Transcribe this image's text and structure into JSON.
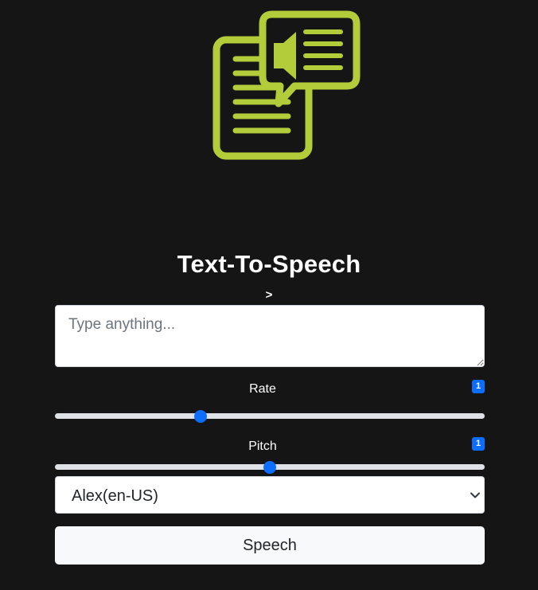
{
  "header": {
    "logo_icon": "text-to-speech-icon",
    "accent_color": "#b2cc3a"
  },
  "title": "Text-To-Speech",
  "subtitle_marker": ">",
  "text_input": {
    "placeholder": "Type anything...",
    "value": ""
  },
  "rate": {
    "label": "Rate",
    "badge": "1",
    "value": 1,
    "min": 0.5,
    "max": 2
  },
  "pitch": {
    "label": "Pitch",
    "badge": "1",
    "value": 1,
    "min": 0,
    "max": 2
  },
  "voice_select": {
    "selected": "Alex(en-US)"
  },
  "speech_button": {
    "label": "Speech"
  },
  "colors": {
    "background": "#151515",
    "primary": "#0d6efd"
  }
}
